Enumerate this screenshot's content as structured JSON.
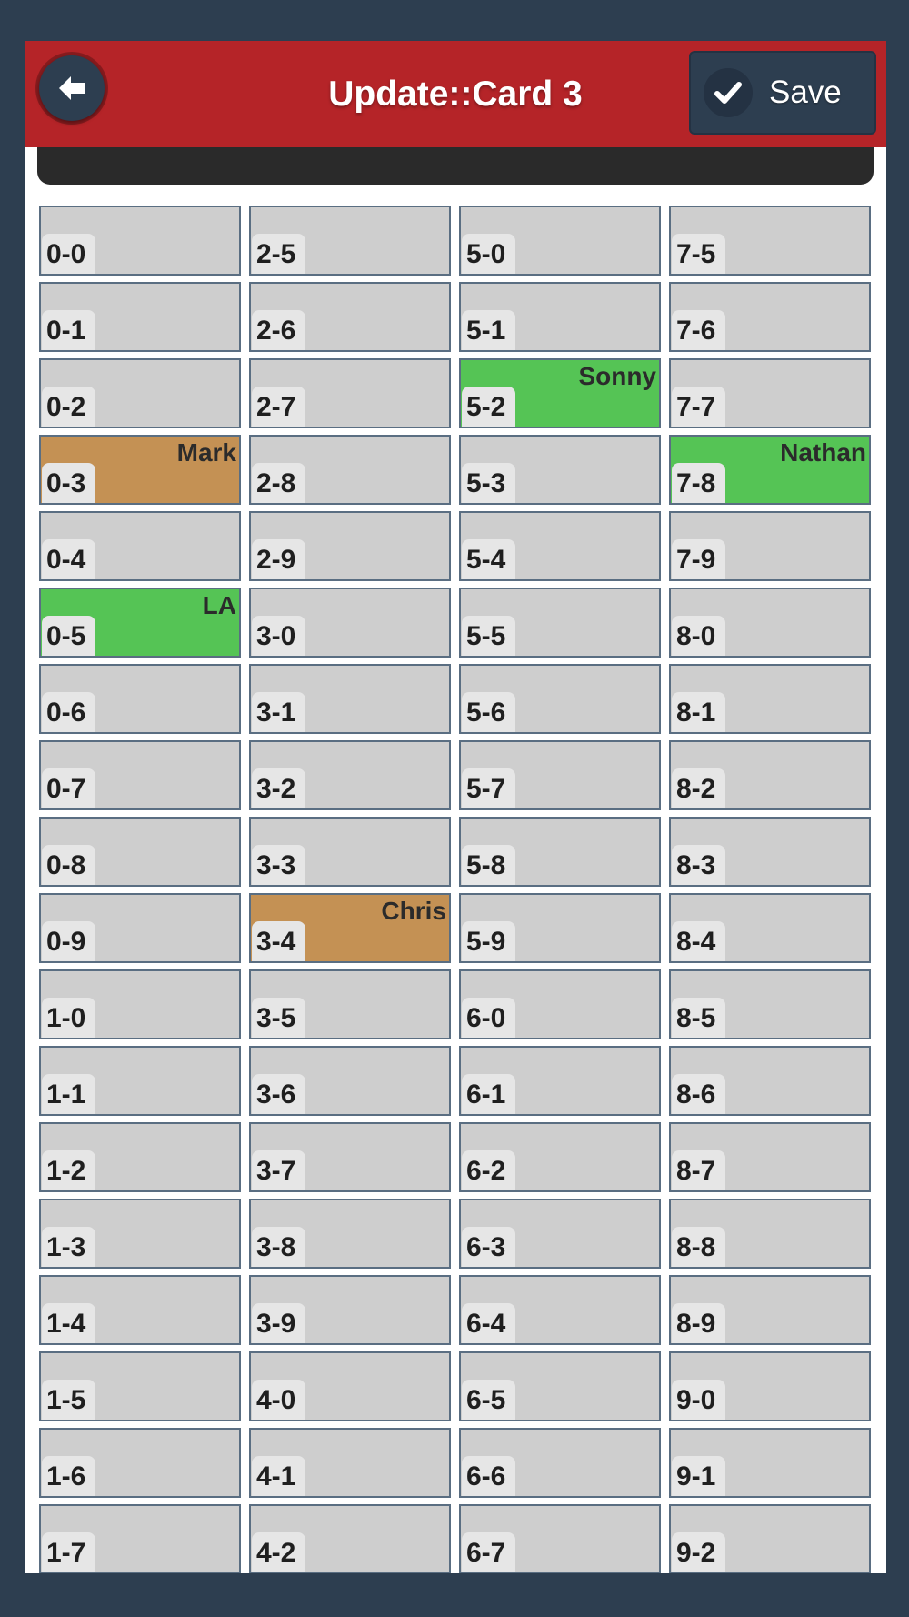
{
  "header": {
    "title": "Update::Card 3",
    "back_icon": "arrow-left-icon",
    "save_label": "Save",
    "save_icon": "checkmark-icon"
  },
  "colors": {
    "header": "#b52428",
    "button": "#2d3e50",
    "cell_default": "#cecece",
    "cell_green": "#55c455",
    "cell_tan": "#c49154"
  },
  "columns": [
    [
      {
        "num": "0-0",
        "name": "",
        "color": ""
      },
      {
        "num": "0-1",
        "name": "",
        "color": ""
      },
      {
        "num": "0-2",
        "name": "",
        "color": ""
      },
      {
        "num": "0-3",
        "name": "Mark",
        "color": "tan"
      },
      {
        "num": "0-4",
        "name": "",
        "color": ""
      },
      {
        "num": "0-5",
        "name": "LA",
        "color": "green"
      },
      {
        "num": "0-6",
        "name": "",
        "color": ""
      },
      {
        "num": "0-7",
        "name": "",
        "color": ""
      },
      {
        "num": "0-8",
        "name": "",
        "color": ""
      },
      {
        "num": "0-9",
        "name": "",
        "color": ""
      },
      {
        "num": "1-0",
        "name": "",
        "color": ""
      },
      {
        "num": "1-1",
        "name": "",
        "color": ""
      },
      {
        "num": "1-2",
        "name": "",
        "color": ""
      },
      {
        "num": "1-3",
        "name": "",
        "color": ""
      },
      {
        "num": "1-4",
        "name": "",
        "color": ""
      },
      {
        "num": "1-5",
        "name": "",
        "color": ""
      },
      {
        "num": "1-6",
        "name": "",
        "color": ""
      },
      {
        "num": "1-7",
        "name": "",
        "color": ""
      }
    ],
    [
      {
        "num": "2-5",
        "name": "",
        "color": ""
      },
      {
        "num": "2-6",
        "name": "",
        "color": ""
      },
      {
        "num": "2-7",
        "name": "",
        "color": ""
      },
      {
        "num": "2-8",
        "name": "",
        "color": ""
      },
      {
        "num": "2-9",
        "name": "",
        "color": ""
      },
      {
        "num": "3-0",
        "name": "",
        "color": ""
      },
      {
        "num": "3-1",
        "name": "",
        "color": ""
      },
      {
        "num": "3-2",
        "name": "",
        "color": ""
      },
      {
        "num": "3-3",
        "name": "",
        "color": ""
      },
      {
        "num": "3-4",
        "name": "Chris",
        "color": "tan"
      },
      {
        "num": "3-5",
        "name": "",
        "color": ""
      },
      {
        "num": "3-6",
        "name": "",
        "color": ""
      },
      {
        "num": "3-7",
        "name": "",
        "color": ""
      },
      {
        "num": "3-8",
        "name": "",
        "color": ""
      },
      {
        "num": "3-9",
        "name": "",
        "color": ""
      },
      {
        "num": "4-0",
        "name": "",
        "color": ""
      },
      {
        "num": "4-1",
        "name": "",
        "color": ""
      },
      {
        "num": "4-2",
        "name": "",
        "color": ""
      }
    ],
    [
      {
        "num": "5-0",
        "name": "",
        "color": ""
      },
      {
        "num": "5-1",
        "name": "",
        "color": ""
      },
      {
        "num": "5-2",
        "name": "Sonny",
        "color": "green"
      },
      {
        "num": "5-3",
        "name": "",
        "color": ""
      },
      {
        "num": "5-4",
        "name": "",
        "color": ""
      },
      {
        "num": "5-5",
        "name": "",
        "color": ""
      },
      {
        "num": "5-6",
        "name": "",
        "color": ""
      },
      {
        "num": "5-7",
        "name": "",
        "color": ""
      },
      {
        "num": "5-8",
        "name": "",
        "color": ""
      },
      {
        "num": "5-9",
        "name": "",
        "color": ""
      },
      {
        "num": "6-0",
        "name": "",
        "color": ""
      },
      {
        "num": "6-1",
        "name": "",
        "color": ""
      },
      {
        "num": "6-2",
        "name": "",
        "color": ""
      },
      {
        "num": "6-3",
        "name": "",
        "color": ""
      },
      {
        "num": "6-4",
        "name": "",
        "color": ""
      },
      {
        "num": "6-5",
        "name": "",
        "color": ""
      },
      {
        "num": "6-6",
        "name": "",
        "color": ""
      },
      {
        "num": "6-7",
        "name": "",
        "color": ""
      }
    ],
    [
      {
        "num": "7-5",
        "name": "",
        "color": ""
      },
      {
        "num": "7-6",
        "name": "",
        "color": ""
      },
      {
        "num": "7-7",
        "name": "",
        "color": ""
      },
      {
        "num": "7-8",
        "name": "Nathan",
        "color": "green"
      },
      {
        "num": "7-9",
        "name": "",
        "color": ""
      },
      {
        "num": "8-0",
        "name": "",
        "color": ""
      },
      {
        "num": "8-1",
        "name": "",
        "color": ""
      },
      {
        "num": "8-2",
        "name": "",
        "color": ""
      },
      {
        "num": "8-3",
        "name": "",
        "color": ""
      },
      {
        "num": "8-4",
        "name": "",
        "color": ""
      },
      {
        "num": "8-5",
        "name": "",
        "color": ""
      },
      {
        "num": "8-6",
        "name": "",
        "color": ""
      },
      {
        "num": "8-7",
        "name": "",
        "color": ""
      },
      {
        "num": "8-8",
        "name": "",
        "color": ""
      },
      {
        "num": "8-9",
        "name": "",
        "color": ""
      },
      {
        "num": "9-0",
        "name": "",
        "color": ""
      },
      {
        "num": "9-1",
        "name": "",
        "color": ""
      },
      {
        "num": "9-2",
        "name": "",
        "color": ""
      }
    ]
  ]
}
